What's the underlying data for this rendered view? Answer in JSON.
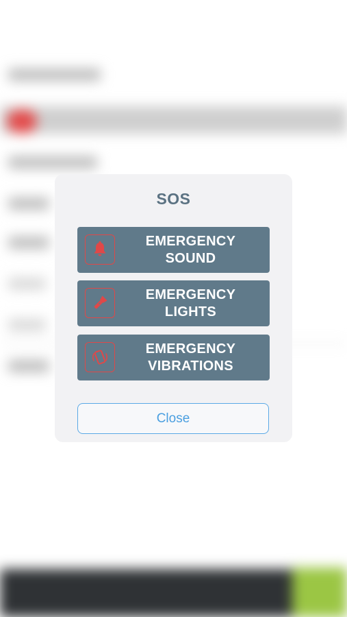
{
  "dialog": {
    "title": "SOS",
    "options": [
      {
        "line1": "EMERGENCY",
        "line2": "SOUND",
        "icon": "bell-icon"
      },
      {
        "line1": "EMERGENCY",
        "line2": "LIGHTS",
        "icon": "flashlight-icon"
      },
      {
        "line1": "EMERGENCY",
        "line2": "VIBRATIONS",
        "icon": "vibrating-phone-icon"
      }
    ],
    "close_label": "Close"
  },
  "colors": {
    "accent_red": "#e04848",
    "button_bg": "#607a8a",
    "title": "#5b7282",
    "close_blue": "#4a9fe0",
    "dialog_bg": "#f2f2f4"
  }
}
